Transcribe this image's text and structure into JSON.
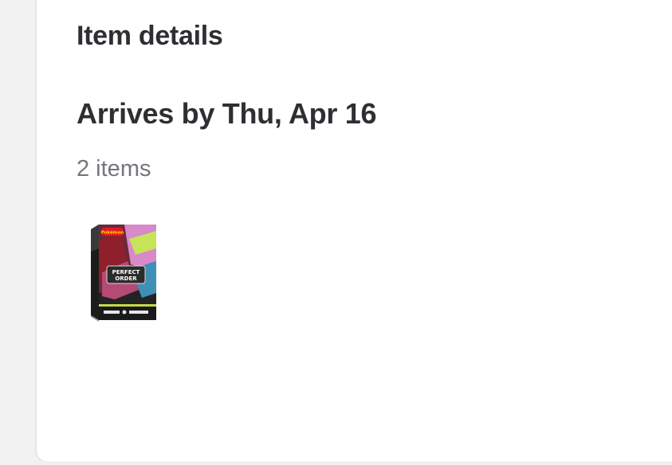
{
  "item_details": {
    "title": "Item details",
    "arrival": "Arrives by Thu, Apr 16",
    "count": "2 items",
    "product": {
      "image_name": "pokemon-perfect-order-booster-box-image",
      "logo_text": "Pokémon",
      "name_line1": "PERFECT",
      "name_line2": "ORDER"
    }
  },
  "colors": {
    "title_text": "#2e2f32",
    "secondary_text": "#74767c",
    "card_bg": "#ffffff",
    "page_bg": "#f2f2f2"
  }
}
